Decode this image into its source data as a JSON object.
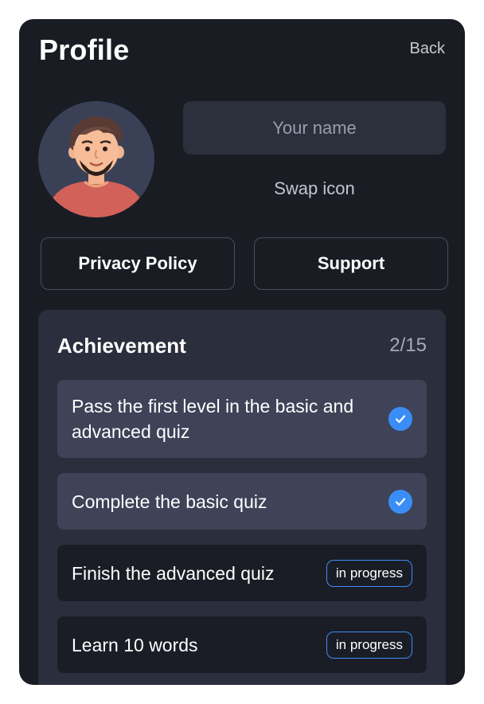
{
  "header": {
    "title": "Profile",
    "back_label": "Back"
  },
  "profile": {
    "name_placeholder": "Your name",
    "name_value": "",
    "swap_icon_label": "Swap icon"
  },
  "actions": {
    "privacy_label": "Privacy Policy",
    "support_label": "Support"
  },
  "achievements": {
    "title": "Achievement",
    "count": "2/15",
    "items": [
      {
        "text": "Pass the first level in the basic and advanced quiz",
        "status": "done"
      },
      {
        "text": "Complete the basic quiz",
        "status": "done"
      },
      {
        "text": "Finish the advanced quiz",
        "status": "in progress"
      },
      {
        "text": "Learn 10 words",
        "status": "in progress"
      }
    ]
  },
  "colors": {
    "background": "#1a1c24",
    "card": "#2b2e3c",
    "accent": "#3b8df6"
  },
  "icons": {
    "avatar": "avatar-illustration",
    "done": "check-icon"
  }
}
